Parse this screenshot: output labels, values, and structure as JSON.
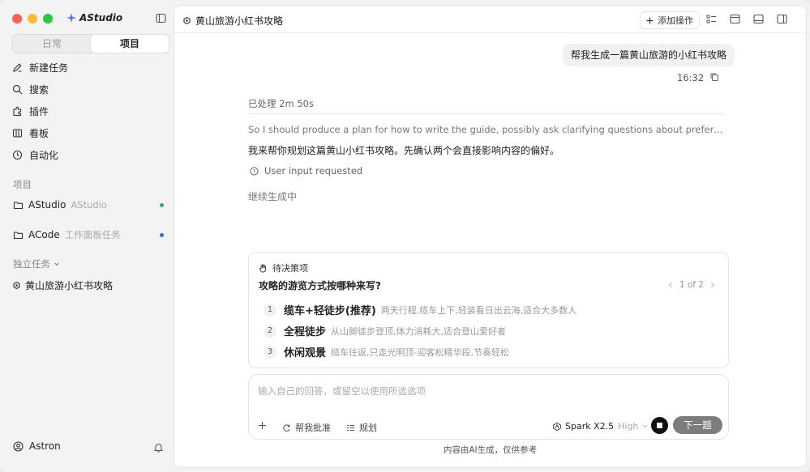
{
  "brand": "AStudio",
  "sidebar": {
    "segments": [
      {
        "label": "日常"
      },
      {
        "label": "项目"
      }
    ],
    "nav": [
      {
        "label": "新建任务",
        "icon": "edit-icon"
      },
      {
        "label": "搜索",
        "icon": "search-icon"
      },
      {
        "label": "插件",
        "icon": "plugin-icon"
      },
      {
        "label": "看板",
        "icon": "board-icon"
      },
      {
        "label": "自动化",
        "icon": "clock-icon"
      }
    ],
    "projects_label": "项目",
    "projects": [
      {
        "name": "AStudio",
        "sub": "AStudio",
        "dot_color": "#22b07d"
      },
      {
        "name": "ACode",
        "sub": "工作面板任务",
        "dot_color": "#2f6bff"
      }
    ],
    "independent_label": "独立任务",
    "task": "黄山旅游小红书攻略",
    "user": "Astron"
  },
  "topbar": {
    "title": "黄山旅游小红书攻略",
    "add_action": "添加操作"
  },
  "chat": {
    "user_message": "帮我生成一篇黄山旅游的小红书攻略",
    "time": "16:32",
    "processed": "已处理 2m 50s",
    "reasoning": "So I should produce a plan for how to write the guide, possibly ask clarifying questions about preferences. But ...",
    "answer": "我来帮你规划这篇黄山小红书攻略。先确认两个会直接影响内容的偏好。",
    "input_requested": "User input requested",
    "continuing": "继续生成中"
  },
  "pending": {
    "header": "待决策项",
    "question": "攻略的游览方式按哪种来写?",
    "pager": "1 of 2",
    "options": [
      {
        "num": "1",
        "title": "缆车+轻徒步(推荐)",
        "desc": "两天行程,缆车上下,轻装看日出云海,适合大多数人"
      },
      {
        "num": "2",
        "title": "全程徒步",
        "desc": "从山脚徒步登顶,体力消耗大,适合登山爱好者"
      },
      {
        "num": "3",
        "title": "休闲观景",
        "desc": "缆车往返,只走光明顶-迎客松精华段,节奏轻松"
      }
    ]
  },
  "composer": {
    "placeholder": "输入自己的回答，或留空以使用所选选项",
    "approve_label": "帮我批准",
    "plan_label": "规划",
    "model_name": "Spark X2.5",
    "model_level": "High",
    "next_label": "下一题"
  },
  "footer_note": "内容由AI生成，仅供参考"
}
